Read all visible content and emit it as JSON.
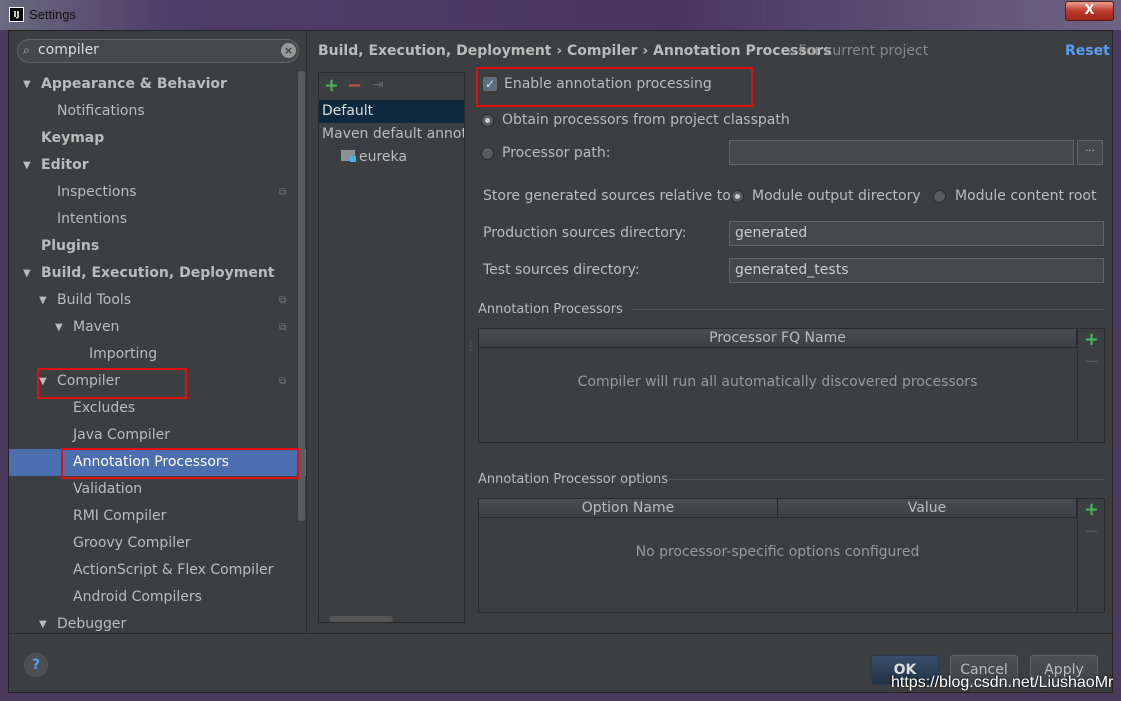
{
  "window": {
    "title": "Settings",
    "app_icon": "IJ",
    "close_label": "X"
  },
  "search": {
    "value": "compiler",
    "icon": "search-icon"
  },
  "tree": [
    {
      "label": "Appearance & Behavior",
      "level": 0,
      "arrow": true,
      "bold": true
    },
    {
      "label": "Notifications",
      "level": 1
    },
    {
      "label": "Keymap",
      "level": 0,
      "bold": true
    },
    {
      "label": "Editor",
      "level": 0,
      "arrow": true,
      "bold": true
    },
    {
      "label": "Inspections",
      "level": 1,
      "project": true
    },
    {
      "label": "Intentions",
      "level": 1
    },
    {
      "label": "Plugins",
      "level": 0,
      "bold": true
    },
    {
      "label": "Build, Execution, Deployment",
      "level": 0,
      "arrow": true,
      "bold": true
    },
    {
      "label": "Build Tools",
      "level": 1,
      "arrow": true,
      "project": true
    },
    {
      "label": "Maven",
      "level": 2,
      "arrow": true,
      "project": true
    },
    {
      "label": "Importing",
      "level": 3
    },
    {
      "label": "Compiler",
      "level": 1,
      "arrow": true,
      "project": true
    },
    {
      "label": "Excludes",
      "level": 2
    },
    {
      "label": "Java Compiler",
      "level": 2
    },
    {
      "label": "Annotation Processors",
      "level": 2,
      "selected": true
    },
    {
      "label": "Validation",
      "level": 2
    },
    {
      "label": "RMI Compiler",
      "level": 2
    },
    {
      "label": "Groovy Compiler",
      "level": 2
    },
    {
      "label": "ActionScript & Flex Compiler",
      "level": 2
    },
    {
      "label": "Android Compilers",
      "level": 2
    },
    {
      "label": "Debugger",
      "level": 1,
      "arrow": true
    }
  ],
  "header": {
    "breadcrumb": "Build, Execution, Deployment › Compiler › Annotation Processors",
    "scope": "For current project",
    "reset": "Reset"
  },
  "profiles": {
    "items": [
      "Default",
      "Maven default annot",
      "eureka"
    ],
    "selected": "Default"
  },
  "form": {
    "enable_label": "Enable annotation processing",
    "enable_checked": true,
    "obtain_label": "Obtain processors from project classpath",
    "path_label": "Processor path:",
    "path_value": "",
    "browse": "...",
    "store_label": "Store generated sources relative to:",
    "module_output": "Module output directory",
    "module_content": "Module content root",
    "prod_label": "Production sources directory:",
    "prod_value": "generated",
    "test_label": "Test sources directory:",
    "test_value": "generated_tests"
  },
  "processors": {
    "title": "Annotation Processors",
    "column": "Processor FQ Name",
    "empty": "Compiler will run all automatically discovered processors"
  },
  "options": {
    "title": "Annotation Processor options",
    "columns": [
      "Option Name",
      "Value"
    ],
    "empty": "No processor-specific options configured"
  },
  "buttons": {
    "help": "?",
    "ok": "OK",
    "cancel": "Cancel",
    "apply": "Apply"
  },
  "watermark": "https://blog.csdn.net/LiushaoMr",
  "colors": {
    "background": "#3c3f41",
    "selection": "#4b6eaf",
    "accent": "#589df6",
    "highlight_box": "#e01010"
  }
}
